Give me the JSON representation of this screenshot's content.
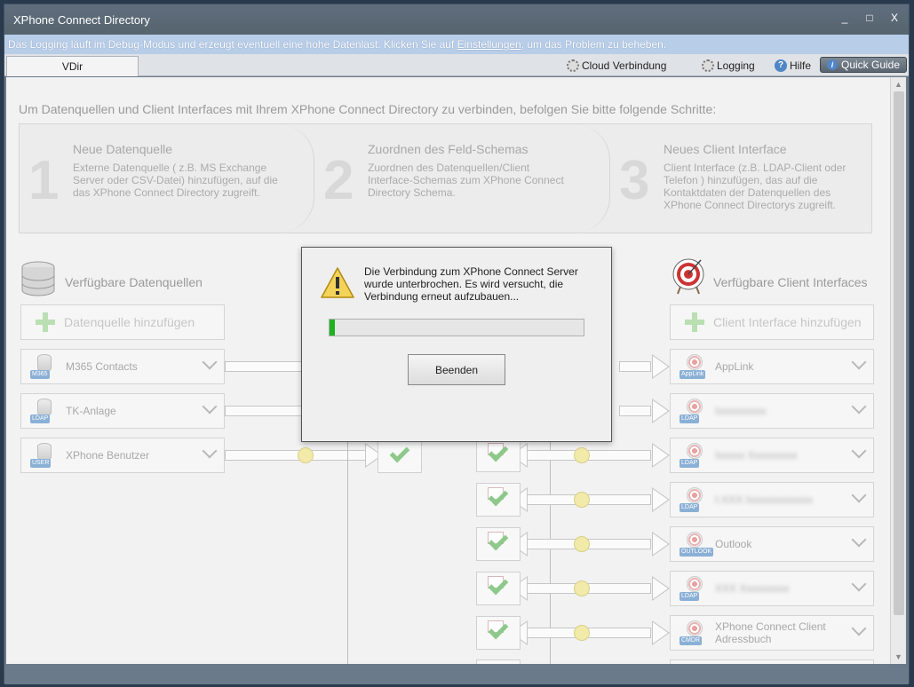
{
  "window": {
    "title": "XPhone Connect Directory",
    "minimize": "_",
    "maximize": "□",
    "close": "X"
  },
  "infobar": {
    "prefix": "Das Logging läuft im Debug-Modus und erzeugt eventuell eine hohe Datenlast. Klicken Sie auf ",
    "link": "Einstellungen",
    "suffix": ", um das Problem zu beheben."
  },
  "tabs": {
    "vdir": "VDir"
  },
  "toolbar": {
    "cloud": "Cloud Verbindung",
    "logging": "Logging",
    "help": "Hilfe",
    "quick_guide": "Quick Guide"
  },
  "intro": "Um Datenquellen und Client Interfaces mit Ihrem XPhone Connect Directory zu verbinden, befolgen Sie bitte folgende Schritte:",
  "steps": [
    {
      "num": "1",
      "title": "Neue Datenquelle",
      "desc": "Externe Datenquelle ( z.B. MS Exchange Server oder CSV-Datei) hinzufügen, auf die das XPhone Connect Directory zugreift."
    },
    {
      "num": "2",
      "title": "Zuordnen des Feld-Schemas",
      "desc": "Zuordnen des Datenquellen/Client Interface-Schemas zum XPhone Connect Directory Schema."
    },
    {
      "num": "3",
      "title": "Neues Client Interface",
      "desc": "Client Interface (z.B. LDAP-Client oder Telefon ) hinzufügen, das auf die Kontaktdaten der Datenquellen des XPhone Connect Directorys zugreift."
    }
  ],
  "sources": {
    "heading": "Verfügbare Datenquellen",
    "add_label": "Datenquelle hinzufügen",
    "items": [
      {
        "label": "M365 Contacts",
        "tag": "M365"
      },
      {
        "label": "TK-Anlage",
        "tag": "LDAP"
      },
      {
        "label": "XPhone Benutzer",
        "tag": "USER"
      }
    ]
  },
  "clients": {
    "heading": "Verfügbare Client Interfaces",
    "add_label": "Client Interface hinzufügen",
    "items": [
      {
        "label": "AppLink",
        "tag": "AppLink"
      },
      {
        "label": "Ixxxxxxxxx",
        "tag": "LDAP",
        "blurred": true
      },
      {
        "label": "Ixxxxx Xxxxxxxxx",
        "tag": "LDAP",
        "blurred": true
      },
      {
        "label": "I-XXX Ixxxxxxxxxxxx",
        "tag": "LDAP",
        "blurred": true
      },
      {
        "label": "Outlook",
        "tag": "OUTLOOK"
      },
      {
        "label": "XXX Xxxxxxxxx",
        "tag": "LDAP",
        "blurred": true
      },
      {
        "label": "XPhone Connect Client Adressbuch",
        "tag": "CMDR"
      }
    ]
  },
  "dialog": {
    "message": "Die Verbindung zum XPhone Connect Server wurde unterbrochen. Es wird versucht, die Verbindung erneut aufzubauen...",
    "progress": 0.02,
    "button": "Beenden"
  },
  "colors": {
    "progress": "#1eb31e",
    "infobar": "#b8cde8",
    "titlebar": "#5f6e7d"
  }
}
